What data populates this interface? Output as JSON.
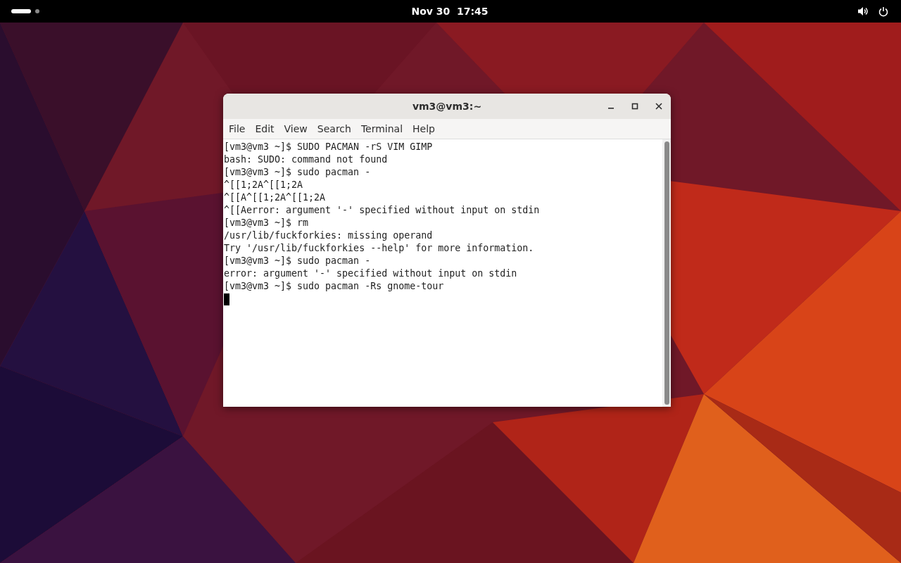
{
  "top_bar": {
    "workspaces": [
      {
        "selected": true
      },
      {
        "selected": false
      }
    ],
    "clock": "Nov 30  17:45"
  },
  "window": {
    "title": "vm3@vm3:~",
    "menu": [
      "File",
      "Edit",
      "View",
      "Search",
      "Terminal",
      "Help"
    ],
    "lines": [
      "[vm3@vm3 ~]$ SUDO PACMAN -rS VIM GIMP",
      "bash: SUDO: command not found",
      "[vm3@vm3 ~]$ sudo pacman -",
      "^[[1;2A^[[1;2A",
      "^[[A^[[1;2A^[[1;2A",
      "^[[Aerror: argument '-' specified without input on stdin",
      "[vm3@vm3 ~]$ rm",
      "/usr/lib/fuckforkies: missing operand",
      "Try '/usr/lib/fuckforkies --help' for more information.",
      "[vm3@vm3 ~]$ sudo pacman -",
      "error: argument '-' specified without input on stdin",
      "[vm3@vm3 ~]$ sudo pacman -Rs gnome-tour"
    ]
  }
}
